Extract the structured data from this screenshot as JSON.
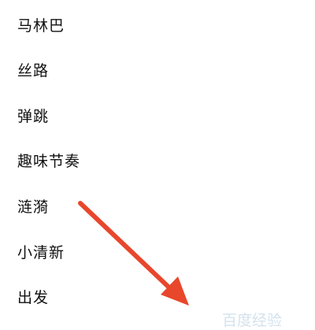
{
  "sound_list": {
    "items": [
      {
        "label": "马林巴"
      },
      {
        "label": "丝路"
      },
      {
        "label": "弹跳"
      },
      {
        "label": "趣味节奏"
      },
      {
        "label": "涟漪"
      },
      {
        "label": "小清新"
      },
      {
        "label": "出发"
      }
    ]
  },
  "annotation": {
    "icon": "arrow-pointer-icon",
    "color": "#e8472c"
  },
  "watermark": {
    "text": "百度经验"
  }
}
